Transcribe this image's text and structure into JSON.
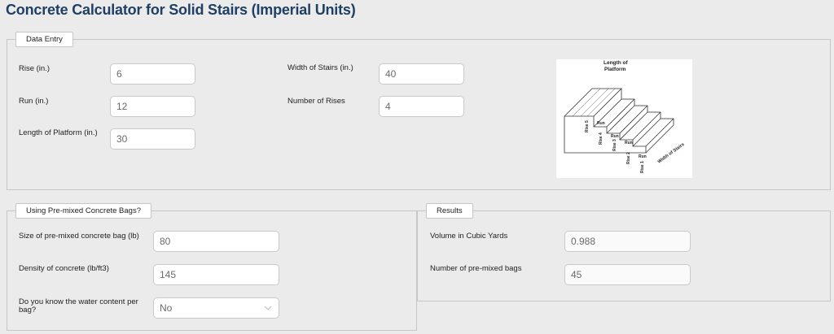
{
  "page_title": "Concrete Calculator for Solid Stairs (Imperial Units)",
  "data_entry": {
    "legend": "Data Entry",
    "rise": {
      "label": "Rise (in.)",
      "value": "6"
    },
    "run": {
      "label": "Run (in.)",
      "value": "12"
    },
    "platform": {
      "label": "Length of Platform (in.)",
      "value": "30"
    },
    "width": {
      "label": "Width of Stairs (in.)",
      "value": "40"
    },
    "rises": {
      "label": "Number of Rises",
      "value": "4"
    },
    "diagram": {
      "length_of": "Length of",
      "platform": "Platform",
      "run": "Run",
      "width_of_stairs": "Width of Stairs",
      "rise1": "Rise 1",
      "rise2": "Rise 2",
      "rise3": "Rise 3",
      "rise4": "Rise 4",
      "rise5": "Rise 5"
    }
  },
  "premixed": {
    "legend": "Using Pre-mixed Concrete Bags?",
    "bag_size": {
      "label": "Size of pre-mixed concrete bag (lb)",
      "value": "80"
    },
    "density": {
      "label": "Density of concrete (lb/ft3)",
      "value": "145"
    },
    "water": {
      "label": "Do you know the water content per bag?",
      "value": "No"
    }
  },
  "results": {
    "legend": "Results",
    "volume": {
      "label": "Volume in Cubic Yards",
      "value": "0.988"
    },
    "bags": {
      "label": "Number of pre-mixed bags",
      "value": "45"
    }
  }
}
